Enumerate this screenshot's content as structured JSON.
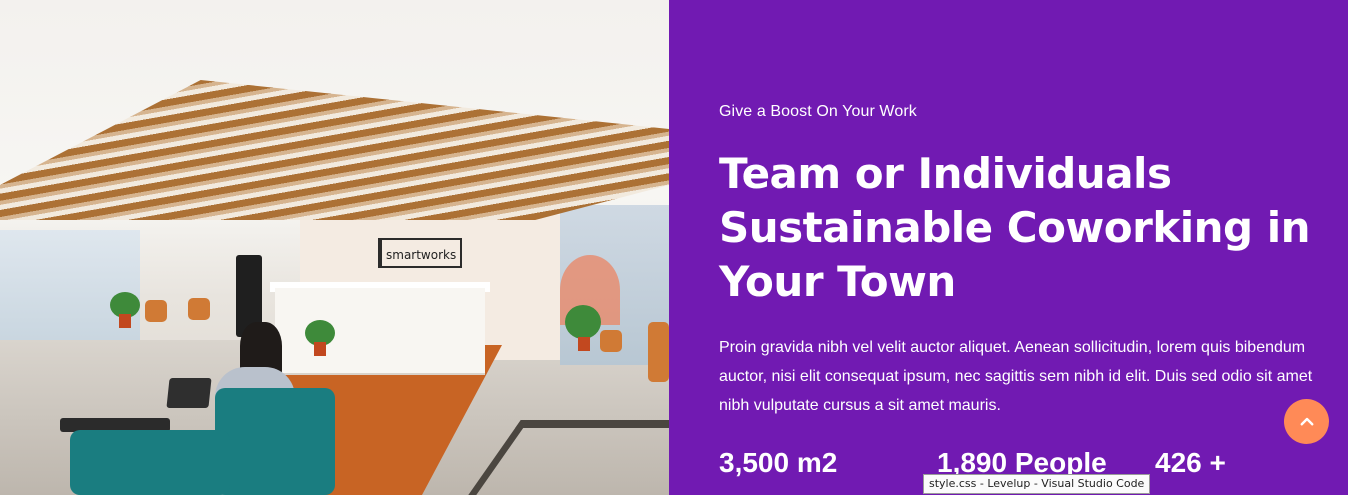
{
  "photo": {
    "alt": "Office lobby with reception desk",
    "sign_text": "smartworks"
  },
  "hero": {
    "eyebrow": "Give a Boost On Your Work",
    "title": "Team or Individuals Sustainable Coworking in Your Town",
    "description": "Proin gravida nibh vel velit auctor aliquet. Aenean sollicitudin, lorem quis bibendum auctor, nisi elit consequat ipsum, nec sagittis sem nibh id elit. Duis sed odio sit amet nibh vulputate cursus a sit amet mauris.",
    "stats": [
      {
        "value": "3,500",
        "unit": "m2"
      },
      {
        "value": "1,890",
        "unit": "People"
      },
      {
        "value": "426",
        "unit": "+"
      }
    ]
  },
  "scroll_top": {
    "icon": "chevron-up-icon"
  },
  "tooltip": {
    "text": "style.css - Levelup - Visual Studio Code"
  },
  "colors": {
    "panel_bg": "#711ab2",
    "accent": "#ff8a57",
    "text": "#ffffff"
  }
}
